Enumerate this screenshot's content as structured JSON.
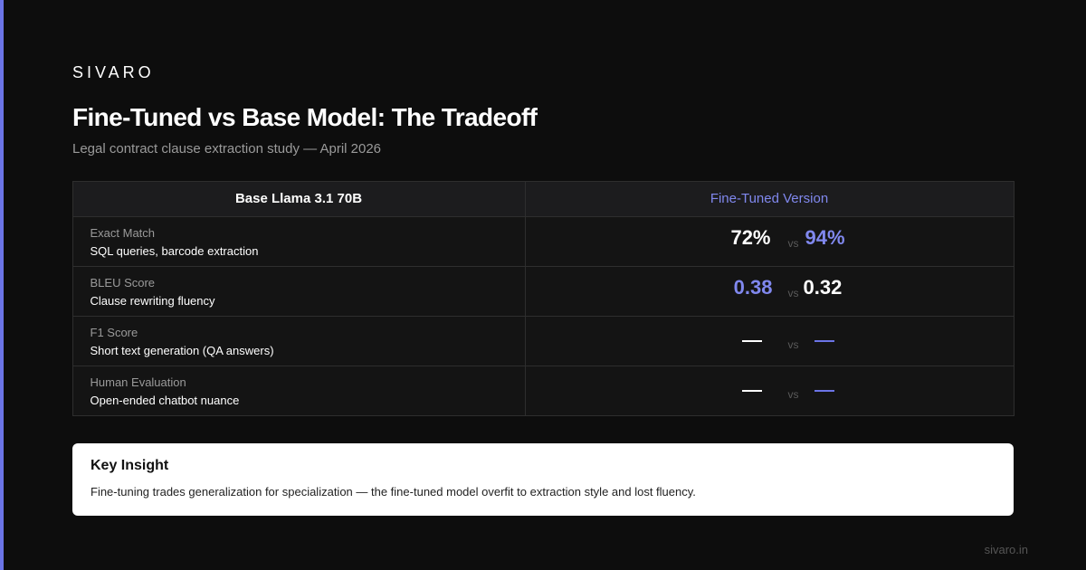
{
  "brand": "SIVARO",
  "title": "Fine-Tuned vs Base Model: The Tradeoff",
  "subtitle": "Legal contract clause extraction study — April 2026",
  "table": {
    "headers": [
      "Base Llama 3.1 70B",
      "Fine-Tuned Version"
    ],
    "rows": [
      {
        "metric": "Exact Match",
        "desc": "SQL queries, barcode extraction",
        "base": "72%",
        "vs": "vs",
        "tuned": "94%",
        "winner": "tuned"
      },
      {
        "metric": "BLEU Score",
        "desc": "Clause rewriting fluency",
        "base": "0.38",
        "vs": "vs",
        "tuned": "0.32",
        "winner": "base"
      },
      {
        "metric": "F1 Score",
        "desc": "Short text generation (QA answers)",
        "base": "",
        "vs": "vs",
        "tuned": "",
        "winner": "none"
      },
      {
        "metric": "Human Evaluation",
        "desc": "Open-ended chatbot nuance",
        "base": "",
        "vs": "vs",
        "tuned": "",
        "winner": "none"
      }
    ]
  },
  "insight": {
    "title": "Key Insight",
    "text": "Fine-tuning trades generalization for specialization — the fine-tuned model overfit to extraction style and lost fluency."
  },
  "footer": "sivaro.in",
  "colors": {
    "accent": "#6b74e6",
    "highlight": "#8088ee",
    "background": "#0d0d0d"
  }
}
